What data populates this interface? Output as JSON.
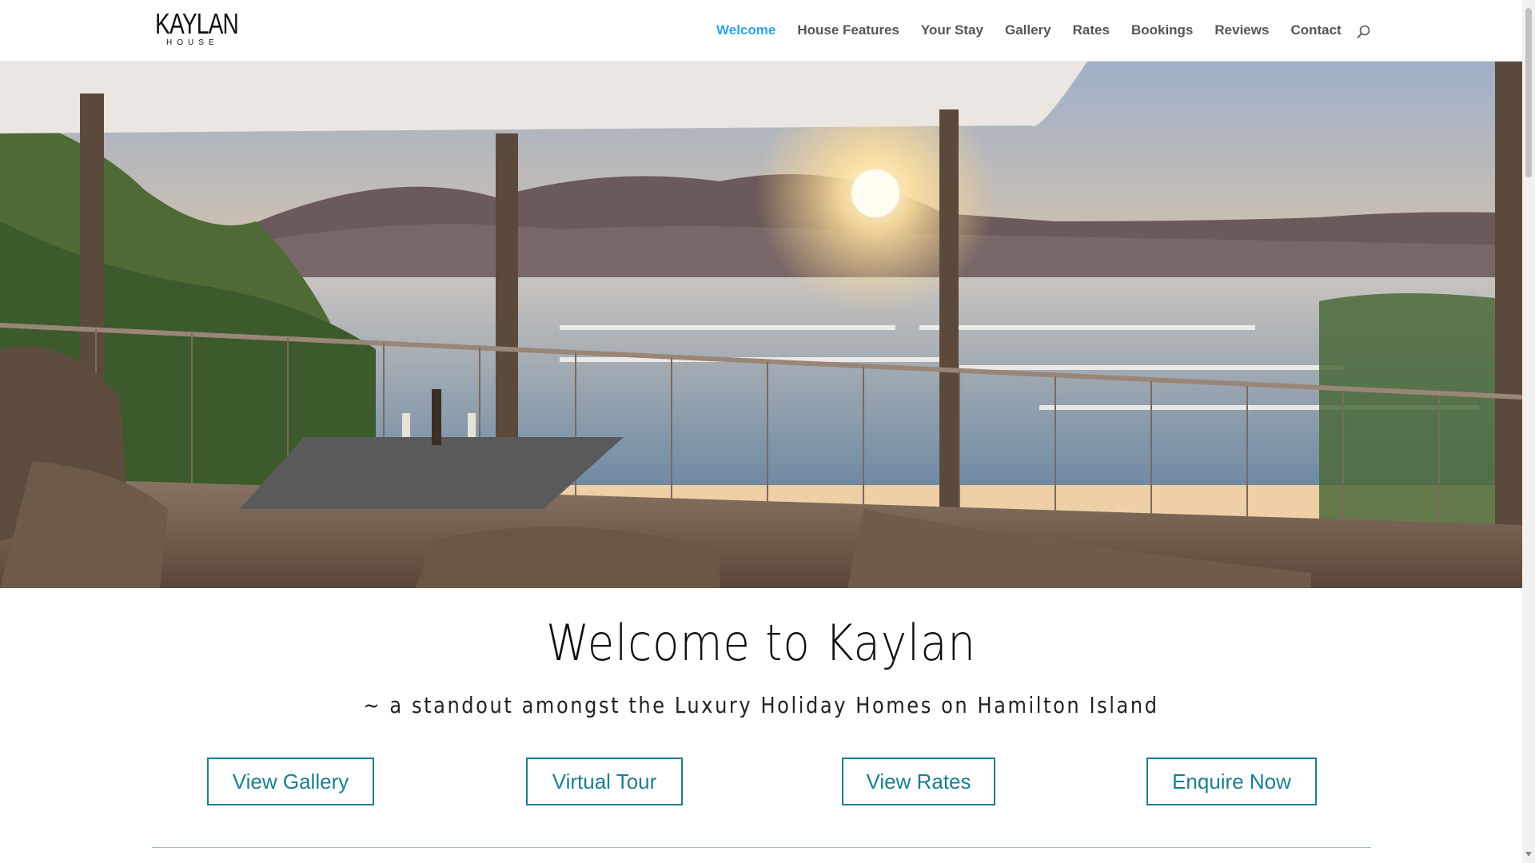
{
  "brand": {
    "name": "KAYLAN",
    "sub": "HOUSE"
  },
  "nav": {
    "items": [
      {
        "label": "Welcome",
        "active": true
      },
      {
        "label": "House Features"
      },
      {
        "label": "Your Stay"
      },
      {
        "label": "Gallery"
      },
      {
        "label": "Rates"
      },
      {
        "label": "Bookings"
      },
      {
        "label": "Reviews"
      },
      {
        "label": "Contact"
      }
    ],
    "search_icon": "search-icon"
  },
  "hero": {
    "image": "balcony view over marina at sunset",
    "icon": "hero-image"
  },
  "welcome": {
    "title": "Welcome to Kaylan",
    "subtitle": "~ a standout amongst the Luxury Holiday Homes on Hamilton Island"
  },
  "buttons": [
    {
      "label": "View Gallery"
    },
    {
      "label": "Virtual Tour"
    },
    {
      "label": "View Rates"
    },
    {
      "label": "Enquire Now"
    }
  ],
  "colors": {
    "accent": "#2ea3f2",
    "button": "#1a7f8c",
    "nav_text": "#555555"
  }
}
